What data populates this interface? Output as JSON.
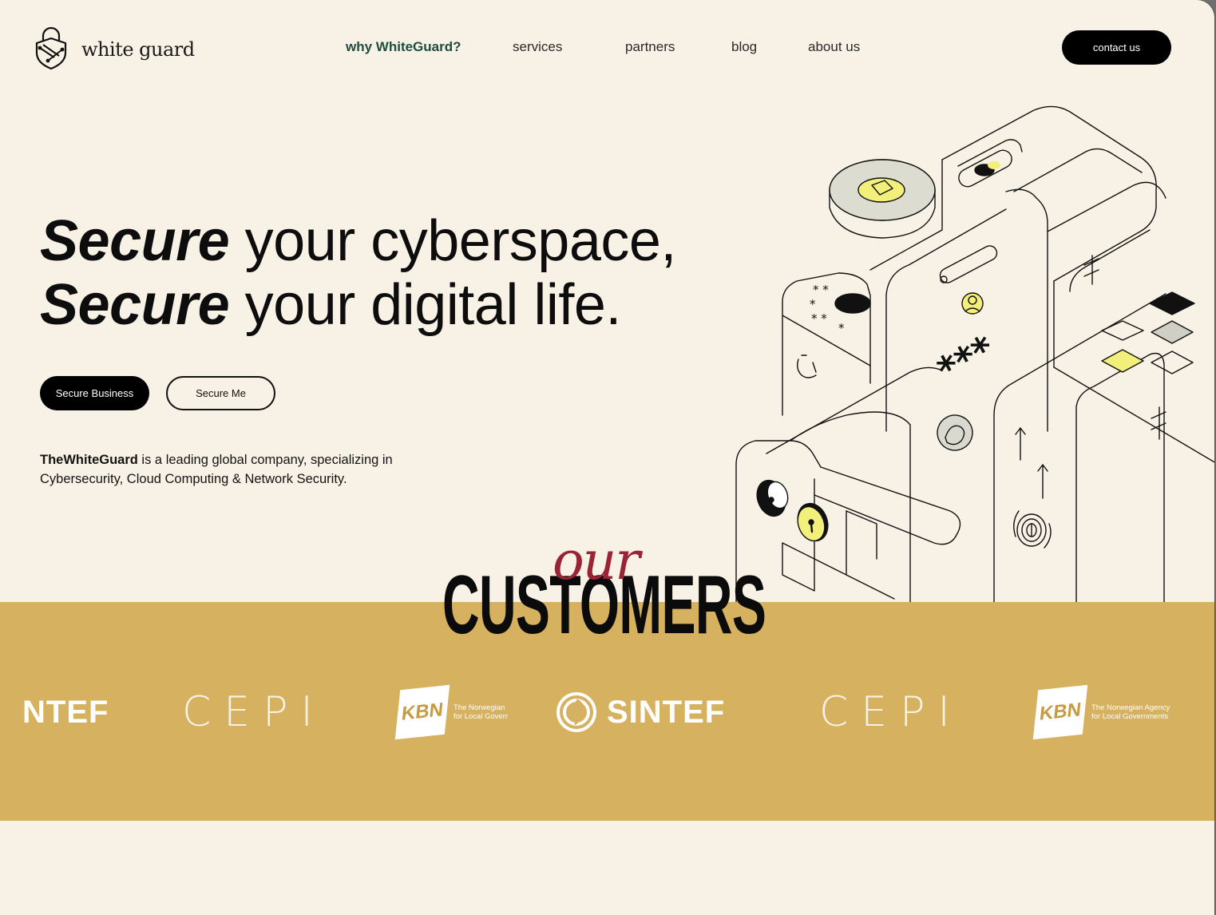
{
  "header": {
    "logo_text": "white guard",
    "nav": [
      {
        "label": "why WhiteGuard?",
        "active": true
      },
      {
        "label": "services",
        "active": false
      },
      {
        "label": "partners",
        "active": false
      },
      {
        "label": "blog",
        "active": false
      },
      {
        "label": "about us",
        "active": false
      }
    ],
    "contact_label": "contact us"
  },
  "hero": {
    "line1_bold": "Secure",
    "line1_rest": " your cyberspace,",
    "line2_bold": "Secure",
    "line2_rest": " your digital life.",
    "primary_button": "Secure Business",
    "secondary_button": "Secure Me",
    "intro_bold": "TheWhiteGuard",
    "intro_rest": " is a leading global company, specializing in Cybersecurity, Cloud Computing & Network Security."
  },
  "customers": {
    "script_word": "our",
    "heading": "CUSTOMERS",
    "logos": [
      {
        "name": "SINTEF",
        "visible_text": "NTEF"
      },
      {
        "name": "CEPI",
        "visible_text": "CEPI"
      },
      {
        "name": "KBN",
        "visible_text": "KBN",
        "caption": "The Norwegian\nfor Local Goverr"
      },
      {
        "name": "SINTEF",
        "visible_text": "SINTEF"
      },
      {
        "name": "CEPI",
        "visible_text": "CEPI"
      },
      {
        "name": "KBN",
        "visible_text": "KBN",
        "caption": "The Norwegian Agency\nfor Local Governments"
      }
    ]
  },
  "colors": {
    "background": "#f8f1e5",
    "band": "#d6b160",
    "accent_green": "#1f4d3f",
    "accent_red": "#9b2336",
    "highlight_yellow": "#f4ef7a"
  },
  "icons": [
    "shield-lock-logo-icon",
    "security-device-illustration"
  ]
}
